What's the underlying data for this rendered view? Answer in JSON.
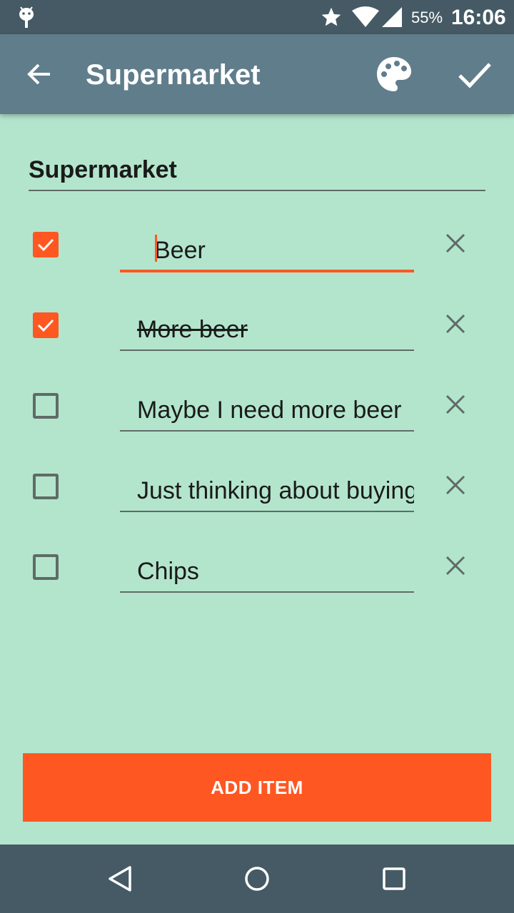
{
  "status_bar": {
    "battery": "55%",
    "time": "16:06",
    "icons": [
      "android-debug-icon",
      "star-icon",
      "wifi-icon",
      "signal-icon"
    ]
  },
  "app_bar": {
    "title": "Supermarket",
    "icons": [
      "back-arrow-icon",
      "palette-icon",
      "check-icon"
    ]
  },
  "list": {
    "title": "Supermarket",
    "items": [
      {
        "text": "Beer",
        "checked": true,
        "focused": true
      },
      {
        "text": "More beer",
        "checked": true,
        "focused": false
      },
      {
        "text": "Maybe I need more beer",
        "checked": false,
        "focused": false
      },
      {
        "text": "Just thinking about buying",
        "checked": false,
        "focused": false
      },
      {
        "text": "Chips",
        "checked": false,
        "focused": false
      }
    ]
  },
  "add_item_label": "ADD ITEM",
  "nav_bar": {
    "icons": [
      "nav-back-icon",
      "nav-home-icon",
      "nav-recents-icon"
    ]
  },
  "colors": {
    "accent": "#ff5722",
    "app_bar": "#607d8b",
    "status_bar": "#455a64",
    "background": "#b3e5cd"
  }
}
